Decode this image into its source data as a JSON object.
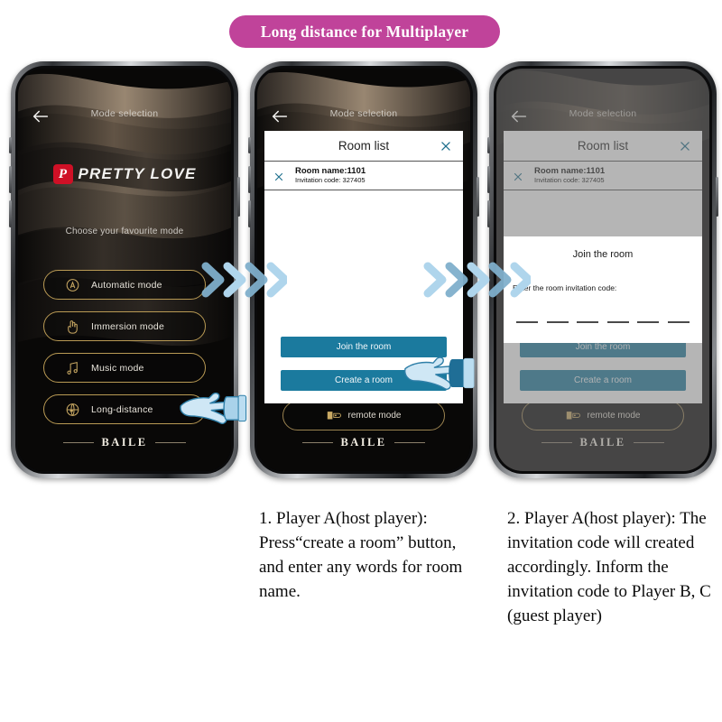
{
  "header": {
    "badge_title": "Long distance for Multiplayer",
    "badge_color": "#C0439A"
  },
  "theme": {
    "accent_teal": "#1B7A9E",
    "gold": "#b99a54",
    "arrow_blue_light": "#AFD5EC",
    "arrow_blue_dark": "#7FAFCB",
    "brand_red": "#cf1026"
  },
  "app": {
    "nav_title": "Mode selection",
    "back_icon": "back-arrow-icon",
    "brand_mark": "P",
    "brand_name": "PRETTY LOVE",
    "choose_prompt": "Choose your favourite mode",
    "footer_word": "BAILE",
    "modes": [
      {
        "label": "Automatic mode",
        "icon": "automatic-mode-icon"
      },
      {
        "label": "Immersion mode",
        "icon": "hand-touch-icon"
      },
      {
        "label": "Music mode",
        "icon": "music-note-icon"
      },
      {
        "label": "Long-distance",
        "icon": "globe-lock-icon"
      }
    ],
    "remote_mode_label": "remote mode",
    "remote_mode_icon": "remote-control-icon"
  },
  "room_list_dialog": {
    "title": "Room list",
    "close_icon": "close-x-icon",
    "row_remove_icon": "close-x-icon",
    "rooms": [
      {
        "name_line": "Room name:1101",
        "code_line": "Invitation code:  327405"
      }
    ],
    "buttons": [
      {
        "label": "Join the room",
        "name": "join-the-room-button"
      },
      {
        "label": "Create a room",
        "name": "create-a-room-button"
      }
    ]
  },
  "join_room_dialog": {
    "title": "Join the room",
    "prompt": "Enter the room invitation code:",
    "code_slots": 6
  },
  "phones": [
    {
      "id": "phone-1",
      "state": "mode-selection"
    },
    {
      "id": "phone-2",
      "state": "room-list"
    },
    {
      "id": "phone-3",
      "state": "join-room"
    }
  ],
  "arrows": {
    "group_1_count": 3,
    "group_2_count": 4,
    "icon": "chevron-right-icon"
  },
  "hands": {
    "hand_1": "pointing-hand-icon",
    "hand_2": "pointing-hand-icon"
  },
  "captions": {
    "step_1": "1. Player A(host player): Press“create a room” button, and enter any words for room name.",
    "step_2": "2. Player A(host player): The invitation code will created accordingly. Inform the invitation code to Player B, C (guest player)"
  }
}
